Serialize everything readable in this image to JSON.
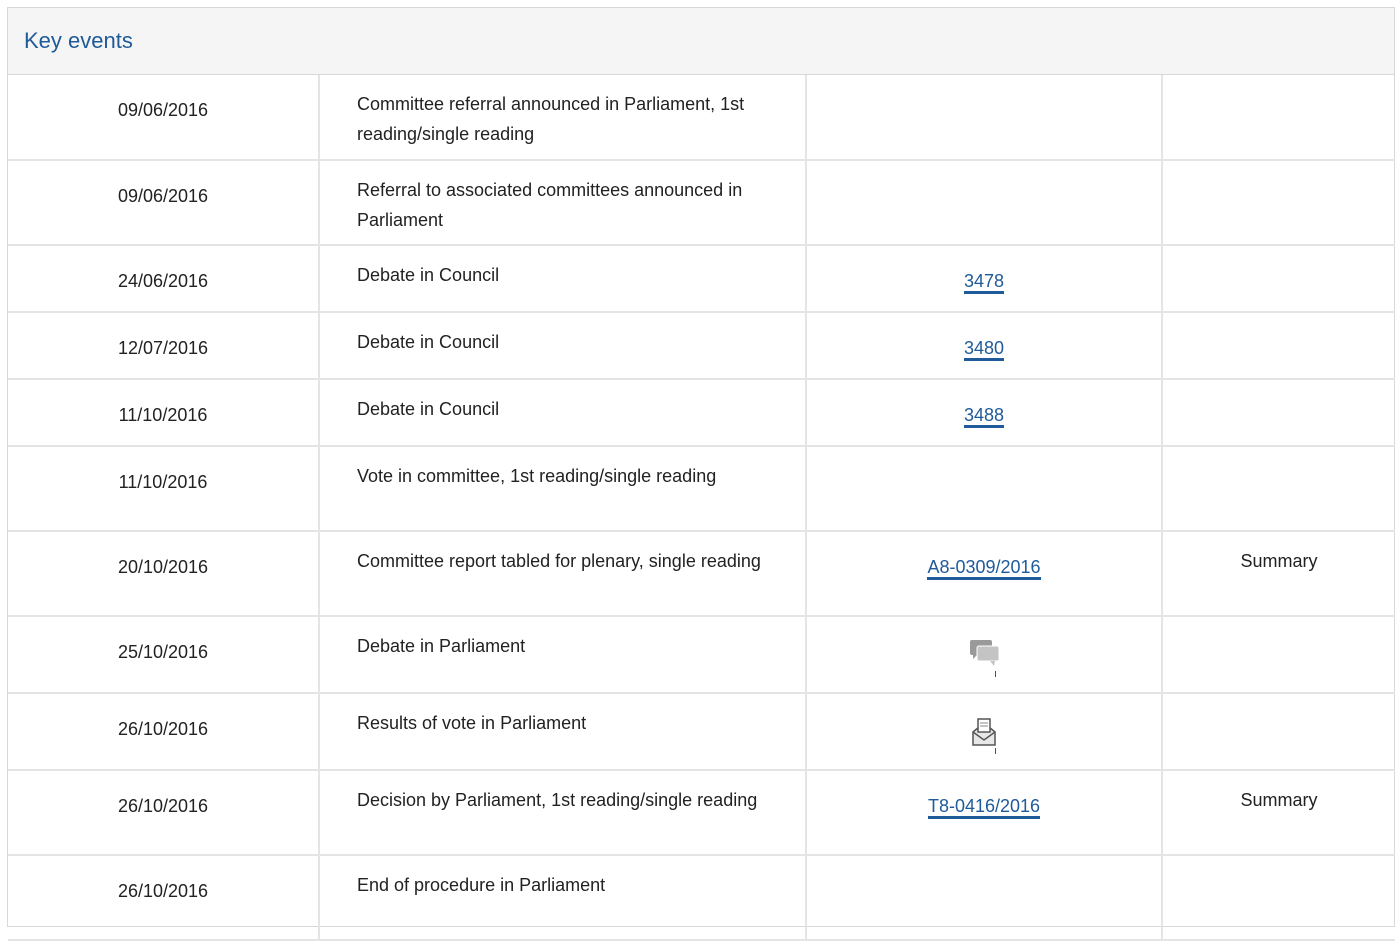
{
  "panel": {
    "title": "Key events"
  },
  "rows": [
    {
      "date": "09/06/2016",
      "event": "Committee referral announced in Parliament, 1st reading/single reading",
      "ref": "",
      "ref_type": "none",
      "summary": ""
    },
    {
      "date": "09/06/2016",
      "event": "Referral to associated committees announced in Parliament",
      "ref": "",
      "ref_type": "none",
      "summary": ""
    },
    {
      "date": "24/06/2016",
      "event": "Debate in Council",
      "ref": "3478",
      "ref_type": "link",
      "summary": ""
    },
    {
      "date": "12/07/2016",
      "event": "Debate in Council",
      "ref": "3480",
      "ref_type": "link",
      "summary": ""
    },
    {
      "date": "11/10/2016",
      "event": "Debate in Council",
      "ref": "3488",
      "ref_type": "link",
      "summary": ""
    },
    {
      "date": "11/10/2016",
      "event": "Vote in committee, 1st reading/single reading",
      "ref": "",
      "ref_type": "none",
      "summary": ""
    },
    {
      "date": "20/10/2016",
      "event": "Committee report tabled for plenary, single reading",
      "ref": "A8-0309/2016",
      "ref_type": "link",
      "summary": "Summary"
    },
    {
      "date": "25/10/2016",
      "event": "Debate in Parliament",
      "ref": "",
      "ref_type": "debate-icon",
      "summary": ""
    },
    {
      "date": "26/10/2016",
      "event": "Results of vote in Parliament",
      "ref": "",
      "ref_type": "vote-icon",
      "summary": ""
    },
    {
      "date": "26/10/2016",
      "event": "Decision by Parliament, 1st reading/single reading",
      "ref": "T8-0416/2016",
      "ref_type": "link",
      "summary": "Summary"
    },
    {
      "date": "26/10/2016",
      "event": "End of procedure in Parliament",
      "ref": "",
      "ref_type": "none",
      "summary": ""
    }
  ],
  "colors": {
    "link": "#1f5a99",
    "header_bg": "#f5f5f5",
    "border": "#e4e4e4"
  }
}
